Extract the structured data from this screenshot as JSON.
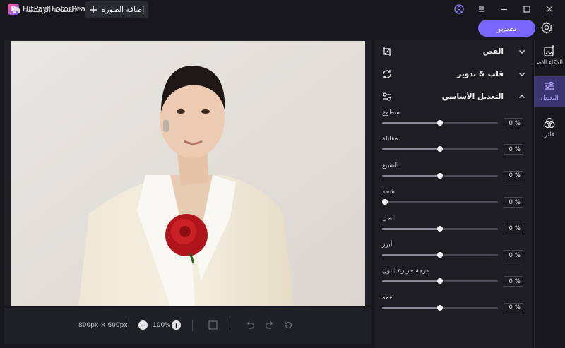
{
  "app": {
    "title": "HitPaw FotorPea",
    "logo_letter": "P"
  },
  "tabs": {
    "home_label": "الصفحة الرئيسية",
    "add_label": "إضافة الصورة"
  },
  "toolbar": {
    "export_label": "تصدير"
  },
  "canvas": {
    "dimensions": "800px × 600px",
    "zoom": "100%"
  },
  "sections": {
    "crop": "القص",
    "flip_rotate": "قلب & تدوير",
    "basic_adjust": "التعديل الأساسي"
  },
  "params": [
    {
      "label": "سطوع",
      "value": "0",
      "unit": "%",
      "fraction": 0.5
    },
    {
      "label": "مقابلة",
      "value": "0",
      "unit": "%",
      "fraction": 0.5
    },
    {
      "label": "التشبع",
      "value": "0",
      "unit": "%",
      "fraction": 0.5
    },
    {
      "label": "شحذ",
      "value": "0",
      "unit": "%",
      "fraction": 0.0
    },
    {
      "label": "الظل",
      "value": "0",
      "unit": "%",
      "fraction": 0.5
    },
    {
      "label": "أبرز",
      "value": "0",
      "unit": "%",
      "fraction": 0.5
    },
    {
      "label": "درجة حرارة اللون",
      "value": "0",
      "unit": "%",
      "fraction": 0.5
    },
    {
      "label": "نغمة",
      "value": "0",
      "unit": "%",
      "fraction": 0.5
    }
  ],
  "sidebar": {
    "items": [
      {
        "label": "الذكاء الاصطناعي",
        "icon": "ai-image-icon",
        "active": false
      },
      {
        "label": "التعديل",
        "icon": "sliders-icon",
        "active": true
      },
      {
        "label": "فلتر",
        "icon": "filter-icon",
        "active": false
      }
    ]
  },
  "colors": {
    "accent": "#7a66ff",
    "active_bg": "#3b3470",
    "panel_bg": "#1d1d23"
  }
}
